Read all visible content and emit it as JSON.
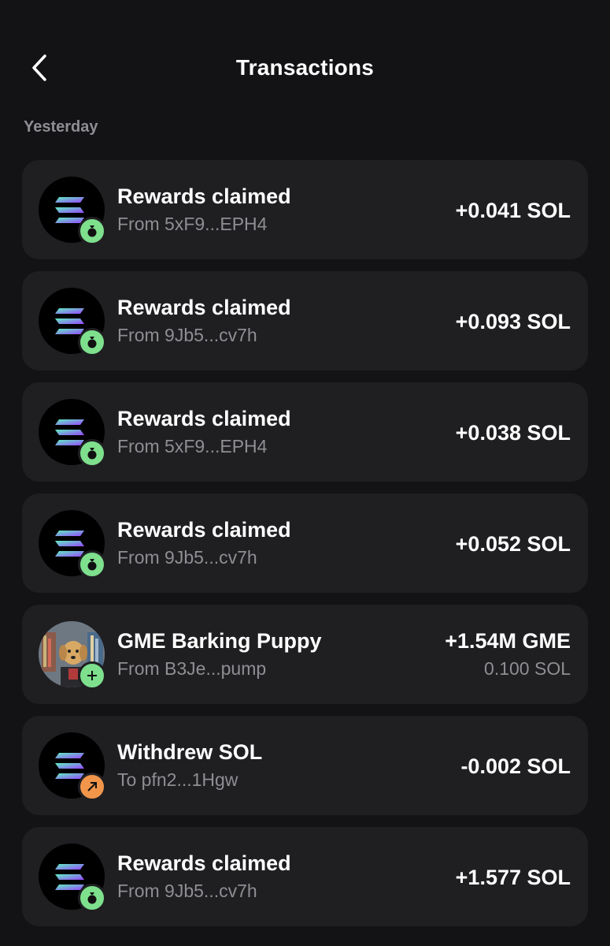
{
  "header": {
    "title": "Transactions"
  },
  "section": {
    "label": "Yesterday"
  },
  "colors": {
    "background": "#131316",
    "card": "#1f1f22",
    "muted": "#8e8e93",
    "badge_green": "#7ee08d",
    "badge_orange": "#f0954a"
  },
  "transactions": [
    {
      "title": "Rewards claimed",
      "subtitle": "From 5xF9...EPH4",
      "amount": "+0.041 SOL",
      "icon": "solana-logo-icon",
      "badge": "money-bag-icon"
    },
    {
      "title": "Rewards claimed",
      "subtitle": "From 9Jb5...cv7h",
      "amount": "+0.093 SOL",
      "icon": "solana-logo-icon",
      "badge": "money-bag-icon"
    },
    {
      "title": "Rewards claimed",
      "subtitle": "From 5xF9...EPH4",
      "amount": "+0.038 SOL",
      "icon": "solana-logo-icon",
      "badge": "money-bag-icon"
    },
    {
      "title": "Rewards claimed",
      "subtitle": "From 9Jb5...cv7h",
      "amount": "+0.052 SOL",
      "icon": "solana-logo-icon",
      "badge": "money-bag-icon"
    },
    {
      "title": "GME Barking Puppy",
      "subtitle": "From B3Je...pump",
      "amount": "+1.54M GME",
      "amount_sub": "0.100 SOL",
      "icon": "dog-token-icon",
      "badge": "plus-icon"
    },
    {
      "title": "Withdrew SOL",
      "subtitle": "To pfn2...1Hgw",
      "amount": "-0.002 SOL",
      "icon": "solana-logo-icon",
      "badge": "arrow-up-right-icon"
    },
    {
      "title": "Rewards claimed",
      "subtitle": "From 9Jb5...cv7h",
      "amount": "+1.577 SOL",
      "icon": "solana-logo-icon",
      "badge": "money-bag-icon"
    }
  ]
}
